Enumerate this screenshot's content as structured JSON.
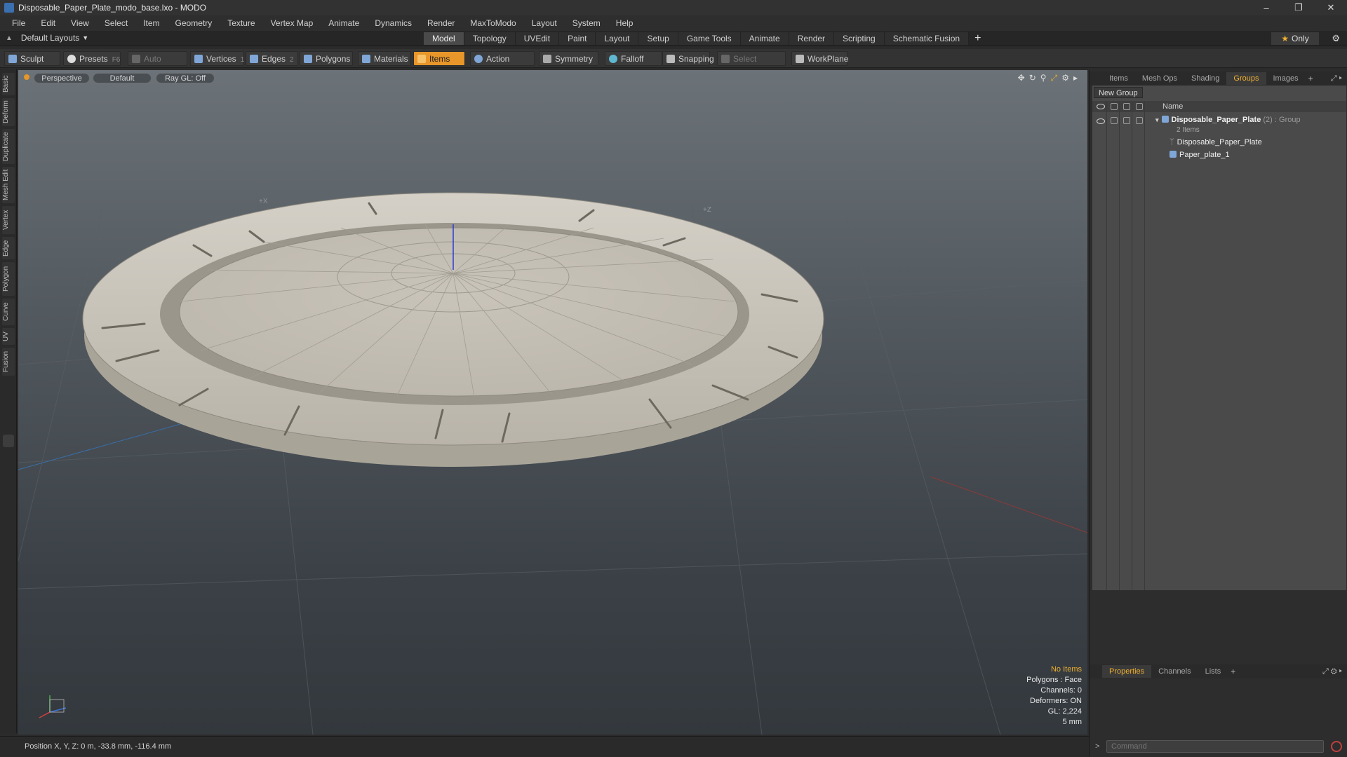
{
  "window": {
    "title": "Disposable_Paper_Plate_modo_base.lxo - MODO"
  },
  "menu": [
    "File",
    "Edit",
    "View",
    "Select",
    "Item",
    "Geometry",
    "Texture",
    "Vertex Map",
    "Animate",
    "Dynamics",
    "Render",
    "MaxToModo",
    "Layout",
    "System",
    "Help"
  ],
  "layout_bar": {
    "layouts_label": "Default Layouts",
    "tabs": [
      "Model",
      "Topology",
      "UVEdit",
      "Paint",
      "Layout",
      "Setup",
      "Game Tools",
      "Animate",
      "Render",
      "Scripting",
      "Schematic Fusion"
    ],
    "active_tab": "Model",
    "only_label": "Only"
  },
  "toolbar": {
    "sculpt": "Sculpt",
    "presets": "Presets",
    "presets_key": "F6",
    "auto_select": "Auto Select",
    "vertices": "Vertices",
    "vertices_key": "1",
    "edges": "Edges",
    "edges_key": "2",
    "polygons": "Polygons",
    "materials": "Materials",
    "items": "Items",
    "action_center": "Action Center",
    "symmetry": "Symmetry",
    "falloff": "Falloff",
    "snapping": "Snapping",
    "select_through": "Select Through",
    "workplane": "WorkPlane"
  },
  "left_tabs": [
    "Basic",
    "Deform",
    "Duplicate",
    "Mesh Edit",
    "Vertex",
    "Edge",
    "Polygon",
    "Curve",
    "UV",
    "Fusion"
  ],
  "viewport": {
    "view": "Perspective",
    "shading": "Default",
    "raygl": "Ray GL: Off",
    "axis_x": "+X",
    "axis_z": "+Z",
    "stats": {
      "selection": "No Items",
      "polygons": "Polygons : Face",
      "channels": "Channels: 0",
      "deformers": "Deformers: ON",
      "gl": "GL: 2,224",
      "scale": "5 mm"
    }
  },
  "status": {
    "position": "Position X, Y, Z:  0 m, -33.8 mm, -116.4 mm"
  },
  "right_panel": {
    "tabs": [
      "Items",
      "Mesh Ops",
      "Shading",
      "Groups",
      "Images"
    ],
    "active_tab": "Groups",
    "new_group": "New Group",
    "name_header": "Name",
    "group": {
      "name": "Disposable_Paper_Plate",
      "count": "(2)",
      "type": ": Group",
      "sub": "2 Items"
    },
    "children": [
      "Disposable_Paper_Plate",
      "Paper_plate_1"
    ],
    "bottom_tabs": [
      "Properties",
      "Channels",
      "Lists"
    ],
    "bottom_active": "Properties",
    "command_placeholder": "Command"
  },
  "colors": {
    "accent": "#e8962a",
    "active_text": "#f0b030"
  }
}
